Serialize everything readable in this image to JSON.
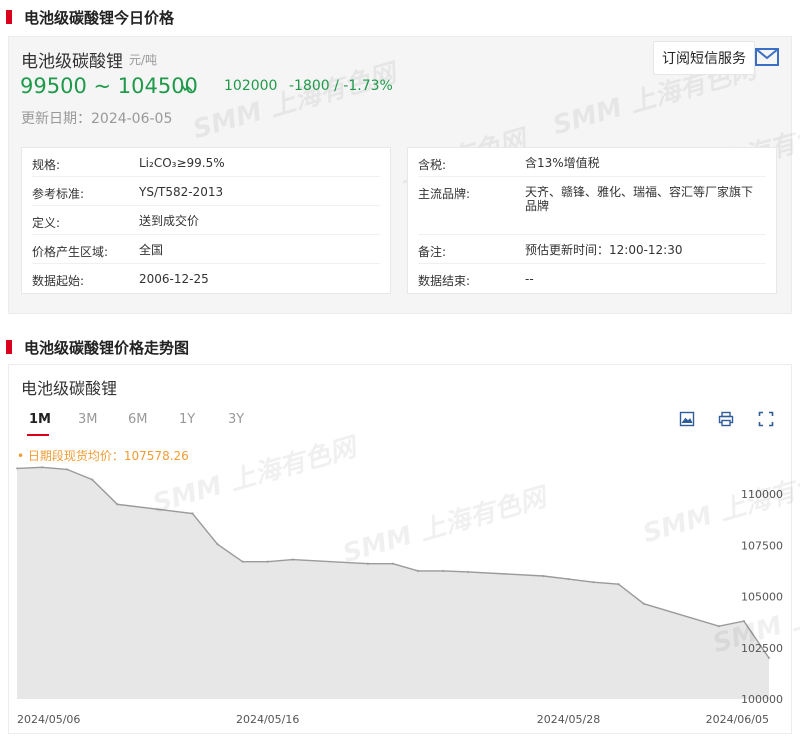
{
  "section1": {
    "title": "电池级碳酸锂今日价格"
  },
  "product": {
    "name": "电池级碳酸锂",
    "unit": "元/吨",
    "subscribe_label": "订阅短信服务",
    "price_range": "99500 ~ 104500",
    "avg": "102000",
    "change": "-1800  /  -1.73%",
    "update_date": "更新日期：2024-06-05",
    "watermark": "SMM 上海有色网"
  },
  "specs_left": [
    {
      "key": "规格:",
      "value": "Li₂CO₃≥99.5%"
    },
    {
      "key": "参考标准:",
      "value": "YS/T582-2013"
    },
    {
      "key": "定义:",
      "value": "送到成交价"
    },
    {
      "key": "价格产生区域:",
      "value": "全国"
    },
    {
      "key": "数据起始:",
      "value": "2006-12-25"
    }
  ],
  "specs_right": [
    {
      "key": "含税:",
      "value": "含13%增值税"
    },
    {
      "key": "主流品牌:",
      "value": "天齐、赣锋、雅化、瑞福、容汇等厂家旗下品牌"
    },
    {
      "key": "备注:",
      "value": "预估更新时间：12:00-12:30"
    },
    {
      "key": "数据结束:",
      "value": "--"
    }
  ],
  "section2": {
    "title": "电池级碳酸锂价格走势图"
  },
  "chart_card": {
    "title": "电池级碳酸锂",
    "tabs": [
      "1M",
      "3M",
      "6M",
      "1Y",
      "3Y"
    ],
    "active_tab": "1M",
    "tooltip": "• 日期段现货均价：107578.26"
  },
  "colors": {
    "green": "#1f9a4a",
    "red_mark": "#d9001b",
    "line": "#9a9a9a",
    "area": "#e3e3e3",
    "tooltip": "#f39c35"
  },
  "chart_data": {
    "type": "area",
    "title": "电池级碳酸锂",
    "x": [
      "2024-05-06",
      "2024-05-07",
      "2024-05-08",
      "2024-05-09",
      "2024-05-10",
      "2024-05-13",
      "2024-05-14",
      "2024-05-15",
      "2024-05-16",
      "2024-05-17",
      "2024-05-20",
      "2024-05-21",
      "2024-05-22",
      "2024-05-23",
      "2024-05-24",
      "2024-05-27",
      "2024-05-28",
      "2024-05-29",
      "2024-05-30",
      "2024-05-31",
      "2024-06-03",
      "2024-06-04",
      "2024-06-05"
    ],
    "values": [
      111250,
      111300,
      111200,
      110700,
      109500,
      109050,
      107550,
      106700,
      106700,
      106800,
      106600,
      106600,
      106250,
      106250,
      106200,
      106000,
      105850,
      105700,
      105600,
      104650,
      103550,
      103800,
      102000
    ],
    "x_tick_labels": [
      "2024/05/06",
      "2024/05/16",
      "2024/05/28",
      "2024/06/05"
    ],
    "x_tick_dates": [
      "2024-05-06",
      "2024-05-16",
      "2024-05-28",
      "2024-06-05"
    ],
    "y_ticks": [
      100000,
      102500,
      105000,
      107500,
      110000
    ],
    "ylim": [
      100000,
      112000
    ],
    "grid": false,
    "xlabel": "",
    "ylabel": ""
  }
}
